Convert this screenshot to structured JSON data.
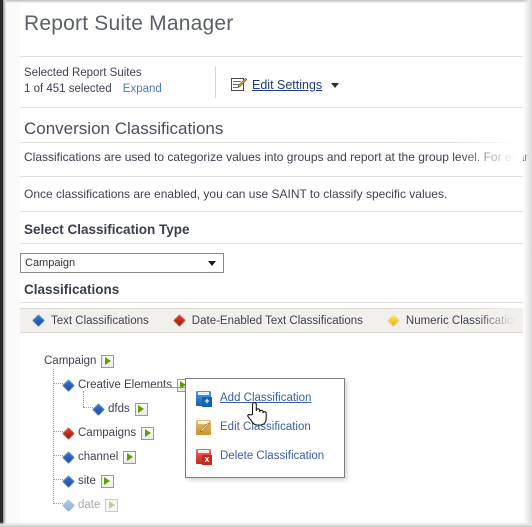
{
  "header": {
    "title": "Report Suite Manager",
    "selected_label": "Selected Report Suites",
    "selected_count": "1 of 451 selected",
    "expand_link": "Expand",
    "edit_settings_label": "Edit Settings",
    "edit_settings_icon": "document-pencil-icon",
    "caret_icon": "caret-down-icon"
  },
  "main": {
    "section_title": "Conversion Classifications",
    "paragraph_1": "Classifications are used to categorize values into groups and report at the group level. For examp",
    "paragraph_2": "Once classifications are enabled, you can use SAINT to classify specific values.",
    "select_type_title": "Select Classification Type",
    "classifications_title": "Classifications"
  },
  "classification_select": {
    "value": "Campaign",
    "caret_icon": "caret-down-icon"
  },
  "legend": {
    "items": [
      {
        "label": "Text Classifications",
        "marker": "diamond-blue",
        "color": "#11439c"
      },
      {
        "label": "Date-Enabled Text Classifications",
        "marker": "diamond-red",
        "color": "#9b1207"
      },
      {
        "label": "Numeric Classifications",
        "marker": "diamond-yellow",
        "color": "#e0b400"
      }
    ]
  },
  "tree": {
    "nodes": [
      {
        "label": "Campaign",
        "marker": "none",
        "depth": 0,
        "disabled": false,
        "arrow_icon": "green-arrow-icon"
      },
      {
        "label": "Creative Elements",
        "marker": "diamond-blue",
        "depth": 1,
        "disabled": false,
        "arrow_icon": "green-arrow-icon"
      },
      {
        "label": "dfds",
        "marker": "diamond-blue",
        "depth": 2,
        "disabled": false,
        "arrow_icon": "green-arrow-icon"
      },
      {
        "label": "Campaigns",
        "marker": "diamond-red",
        "depth": 1,
        "disabled": false,
        "arrow_icon": "green-arrow-icon"
      },
      {
        "label": "channel",
        "marker": "diamond-blue",
        "depth": 1,
        "disabled": false,
        "arrow_icon": "green-arrow-icon"
      },
      {
        "label": "site",
        "marker": "diamond-blue",
        "depth": 1,
        "disabled": false,
        "arrow_icon": "green-arrow-icon"
      },
      {
        "label": "date",
        "marker": "diamond-blue-dim",
        "depth": 1,
        "disabled": true,
        "arrow_icon": "green-arrow-icon"
      }
    ]
  },
  "context_menu": {
    "items": [
      {
        "label": "Add Classification",
        "icon": "add-classification-icon",
        "active": true
      },
      {
        "label": "Edit Classification",
        "icon": "edit-classification-icon",
        "active": false
      },
      {
        "label": "Delete Classification",
        "icon": "delete-classification-icon",
        "active": false
      }
    ]
  },
  "cursor": {
    "type": "pointing-hand-cursor"
  },
  "colors": {
    "link": "#4a7ebb",
    "menu_link": "#3a5fa8",
    "legend_bar_bg": "#f1f0ec",
    "arrow_green": "#5fa000"
  }
}
